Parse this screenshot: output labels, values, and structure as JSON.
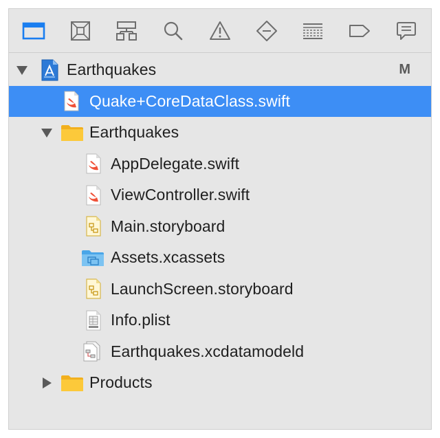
{
  "toolbar": {
    "items": [
      {
        "name": "project-navigator-icon",
        "selected": true
      },
      {
        "name": "source-control-navigator-icon",
        "selected": false
      },
      {
        "name": "symbol-navigator-icon",
        "selected": false
      },
      {
        "name": "find-navigator-icon",
        "selected": false
      },
      {
        "name": "issue-navigator-icon",
        "selected": false
      },
      {
        "name": "test-navigator-icon",
        "selected": false
      },
      {
        "name": "debug-navigator-icon",
        "selected": false
      },
      {
        "name": "breakpoint-navigator-icon",
        "selected": false
      },
      {
        "name": "report-navigator-icon",
        "selected": false
      }
    ],
    "accent_color": "#1a7ef0",
    "icon_color": "#6e6e6e"
  },
  "tree": {
    "project": {
      "label": "Earthquakes",
      "badge": "M",
      "icon": "xcode-project-icon",
      "expanded": true
    },
    "selected_file": {
      "label": "Quake+CoreDataClass.swift",
      "icon": "swift-file-icon"
    },
    "group": {
      "label": "Earthquakes",
      "icon": "folder-icon",
      "expanded": true,
      "files": [
        {
          "label": "AppDelegate.swift",
          "icon": "swift-file-icon"
        },
        {
          "label": "ViewController.swift",
          "icon": "swift-file-icon"
        },
        {
          "label": "Main.storyboard",
          "icon": "storyboard-file-icon"
        },
        {
          "label": "Assets.xcassets",
          "icon": "asset-catalog-icon"
        },
        {
          "label": "LaunchScreen.storyboard",
          "icon": "storyboard-file-icon"
        },
        {
          "label": "Info.plist",
          "icon": "plist-file-icon"
        },
        {
          "label": "Earthquakes.xcdatamodeld",
          "icon": "data-model-icon"
        }
      ]
    },
    "products": {
      "label": "Products",
      "icon": "folder-icon",
      "expanded": false
    }
  },
  "colors": {
    "selection": "#3d8ef5",
    "panel_background": "#e6e6e6",
    "folder": "#f7c02a",
    "swift": "#f05138"
  }
}
